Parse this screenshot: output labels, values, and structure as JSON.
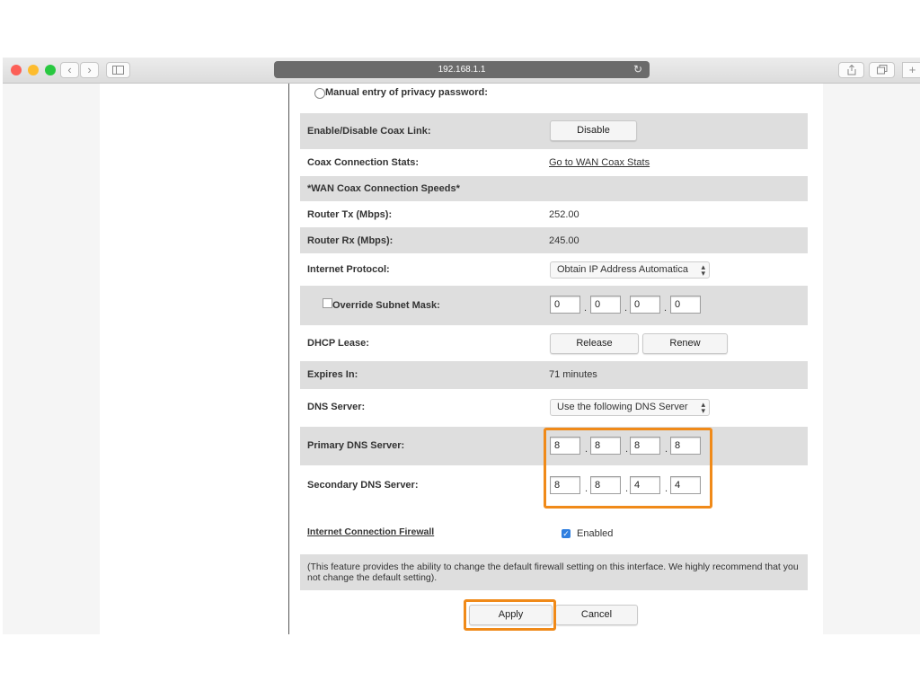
{
  "browser": {
    "url": "192.168.1.1"
  },
  "form": {
    "privacy_radio_label": "Manual entry of privacy password:",
    "coax_link": {
      "label": "Enable/Disable Coax Link:",
      "button": "Disable"
    },
    "coax_stats": {
      "label": "Coax Connection Stats:",
      "link": "Go to WAN Coax Stats"
    },
    "coax_speeds_header": "*WAN Coax Connection Speeds*",
    "router_tx": {
      "label": "Router Tx (Mbps):",
      "value": "252.00"
    },
    "router_rx": {
      "label": "Router Rx (Mbps):",
      "value": "245.00"
    },
    "internet_protocol": {
      "label": "Internet Protocol:",
      "selected": "Obtain IP Address Automatica"
    },
    "subnet_mask": {
      "label": "Override Subnet Mask:",
      "octets": [
        "0",
        "0",
        "0",
        "0"
      ],
      "checked": false
    },
    "dhcp_lease": {
      "label": "DHCP Lease:",
      "release": "Release",
      "renew": "Renew"
    },
    "expires_in": {
      "label": "Expires In:",
      "value": "71 minutes"
    },
    "dns_server": {
      "label": "DNS Server:",
      "selected": "Use the following DNS Server"
    },
    "primary_dns": {
      "label": "Primary DNS Server:",
      "octets": [
        "8",
        "8",
        "8",
        "8"
      ]
    },
    "secondary_dns": {
      "label": "Secondary DNS Server:",
      "octets": [
        "8",
        "8",
        "4",
        "4"
      ]
    },
    "firewall": {
      "label": "Internet Connection Firewall",
      "checkbox_label": "Enabled",
      "checked": true
    },
    "firewall_note": "(This feature provides the ability to change the default firewall setting on this interface. We highly recommend that you not change the default setting).",
    "apply_label": "Apply",
    "cancel_label": "Cancel"
  },
  "colors": {
    "highlight": "#f08a19",
    "row_shade": "#dedede",
    "checkbox_blue": "#2f7fe0"
  }
}
